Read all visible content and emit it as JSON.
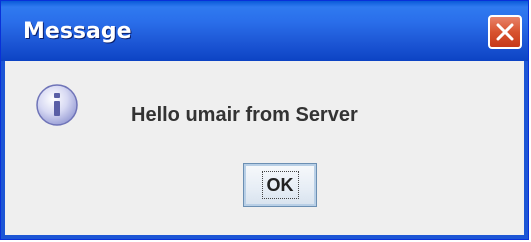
{
  "window": {
    "title": "Message",
    "close_icon": "close-icon",
    "close_color": "#d8532f",
    "titlebar_color": "#2a6eea"
  },
  "dialog": {
    "icon": "info-icon",
    "icon_glyph": "i",
    "message": "Hello umair from Server",
    "ok_label": "OK"
  }
}
